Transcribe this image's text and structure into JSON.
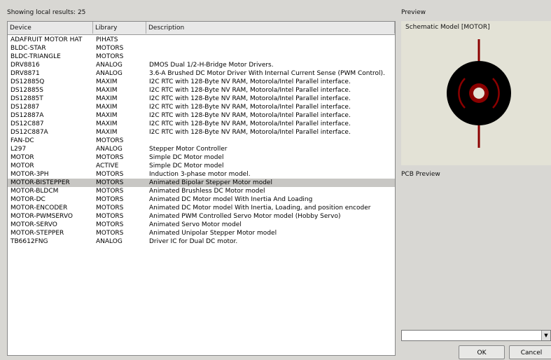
{
  "status_text": "Showing local results: 25",
  "columns": {
    "device": "Device",
    "library": "Library",
    "description": "Description"
  },
  "selected_index": 17,
  "rows": [
    {
      "device": "ADAFRUIT MOTOR HAT",
      "library": "PIHATS",
      "description": ""
    },
    {
      "device": "BLDC-STAR",
      "library": "MOTORS",
      "description": ""
    },
    {
      "device": "BLDC-TRIANGLE",
      "library": "MOTORS",
      "description": ""
    },
    {
      "device": "DRV8816",
      "library": "ANALOG",
      "description": "DMOS Dual 1/2-H-Bridge Motor Drivers."
    },
    {
      "device": "DRV8871",
      "library": "ANALOG",
      "description": "3.6-A Brushed DC Motor Driver With Internal Current Sense (PWM Control)."
    },
    {
      "device": "DS12885Q",
      "library": "MAXIM",
      "description": "I2C RTC with 128-Byte NV RAM, Motorola/Intel Parallel interface."
    },
    {
      "device": "DS12885S",
      "library": "MAXIM",
      "description": "I2C RTC with 128-Byte NV RAM, Motorola/Intel Parallel interface."
    },
    {
      "device": "DS12885T",
      "library": "MAXIM",
      "description": "I2C RTC with 128-Byte NV RAM, Motorola/Intel Parallel interface."
    },
    {
      "device": "DS12887",
      "library": "MAXIM",
      "description": "I2C RTC with 128-Byte NV RAM, Motorola/Intel Parallel interface."
    },
    {
      "device": "DS12887A",
      "library": "MAXIM",
      "description": "I2C RTC with 128-Byte NV RAM, Motorola/Intel Parallel interface."
    },
    {
      "device": "DS12C887",
      "library": "MAXIM",
      "description": "I2C RTC with 128-Byte NV RAM, Motorola/Intel Parallel interface."
    },
    {
      "device": "DS12C887A",
      "library": "MAXIM",
      "description": "I2C RTC with 128-Byte NV RAM, Motorola/Intel Parallel interface."
    },
    {
      "device": "FAN-DC",
      "library": "MOTORS",
      "description": ""
    },
    {
      "device": "L297",
      "library": "ANALOG",
      "description": "Stepper Motor Controller"
    },
    {
      "device": "MOTOR",
      "library": "MOTORS",
      "description": "Simple DC Motor model"
    },
    {
      "device": "MOTOR",
      "library": "ACTIVE",
      "description": "Simple DC Motor model"
    },
    {
      "device": "MOTOR-3PH",
      "library": "MOTORS",
      "description": "Induction 3-phase motor model."
    },
    {
      "device": "MOTOR-BISTEPPER",
      "library": "MOTORS",
      "description": "Animated Bipolar Stepper Motor model"
    },
    {
      "device": "MOTOR-BLDCM",
      "library": "MOTORS",
      "description": "Animated Brushless DC Motor model"
    },
    {
      "device": "MOTOR-DC",
      "library": "MOTORS",
      "description": "Animated DC Motor model With Inertia And Loading"
    },
    {
      "device": "MOTOR-ENCODER",
      "library": "MOTORS",
      "description": "Animated DC Motor model With Inertia, Loading, and position encoder"
    },
    {
      "device": "MOTOR-PWMSERVO",
      "library": "MOTORS",
      "description": "Animated PWM Controlled Servo Motor model (Hobby Servo)"
    },
    {
      "device": "MOTOR-SERVO",
      "library": "MOTORS",
      "description": "Animated Servo Motor model"
    },
    {
      "device": "MOTOR-STEPPER",
      "library": "MOTORS",
      "description": "Animated Unipolar Stepper Motor model"
    },
    {
      "device": "TB6612FNG",
      "library": "ANALOG",
      "description": "Driver IC for Dual DC motor."
    }
  ],
  "preview": {
    "title": "Preview",
    "schematic_label": "Schematic Model [MOTOR]",
    "pcb_title": "PCB Preview",
    "combo_value": "",
    "colors": {
      "body": "#000000",
      "accent": "#8b0000",
      "background": "#e3e2d6"
    }
  },
  "buttons": {
    "ok": "OK",
    "cancel": "Cancel"
  }
}
